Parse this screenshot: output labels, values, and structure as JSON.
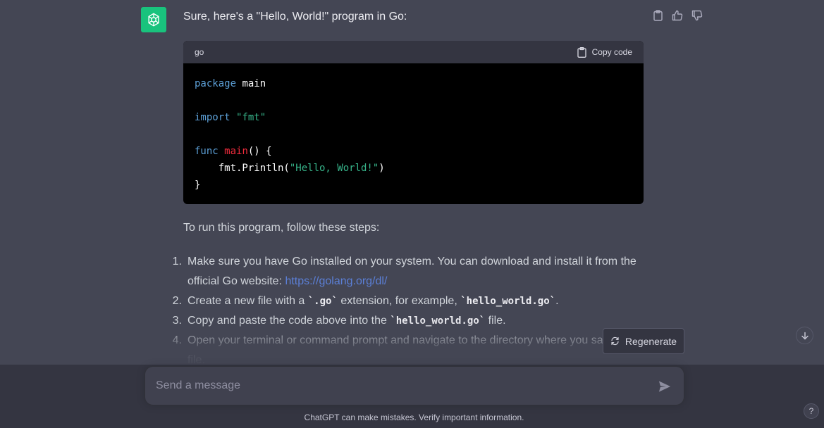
{
  "message": {
    "intro": "Sure, here's a \"Hello, World!\" program in Go:",
    "avatar_icon": "openai-logo-icon",
    "actions": [
      {
        "name": "copy-icon"
      },
      {
        "name": "thumbs-up-icon"
      },
      {
        "name": "thumbs-down-icon"
      }
    ]
  },
  "code_block": {
    "language": "go",
    "copy_label": "Copy code",
    "lines": {
      "l1_kw": "package",
      "l1_rest": " main",
      "l3_kw": "import",
      "l3_str": "\"fmt\"",
      "l5_kw": "func",
      "l5_fn": "main",
      "l5_rest": "() {",
      "l6_indent": "    fmt.Println(",
      "l6_str": "\"Hello, World!\"",
      "l6_close": ")",
      "l7": "}"
    }
  },
  "instructions": {
    "lead": "To run this program, follow these steps:",
    "steps": [
      {
        "num": "1.",
        "text": "Make sure you have Go installed on your system. You can download and install it from the official Go website: ",
        "link": "https://golang.org/dl/"
      },
      {
        "num": "2.",
        "pre": "Create a new file with a ",
        "code1": "`.go`",
        "mid": " extension, for example, ",
        "code2": "`hello_world.go`",
        "post": "."
      },
      {
        "num": "3.",
        "pre": "Copy and paste the code above into the ",
        "code1": "`hello_world.go`",
        "post": " file."
      },
      {
        "num": "4.",
        "text": "Open your terminal or command prompt and navigate to the directory where you saved the file."
      }
    ]
  },
  "regenerate_label": "Regenerate",
  "composer": {
    "placeholder": "Send a message"
  },
  "footer_note": "ChatGPT can make mistakes. Verify important information.",
  "help_label": "?",
  "colors": {
    "avatar_bg": "#19c37d",
    "conversation_bg": "#444654",
    "link": "#5b7fd6"
  }
}
